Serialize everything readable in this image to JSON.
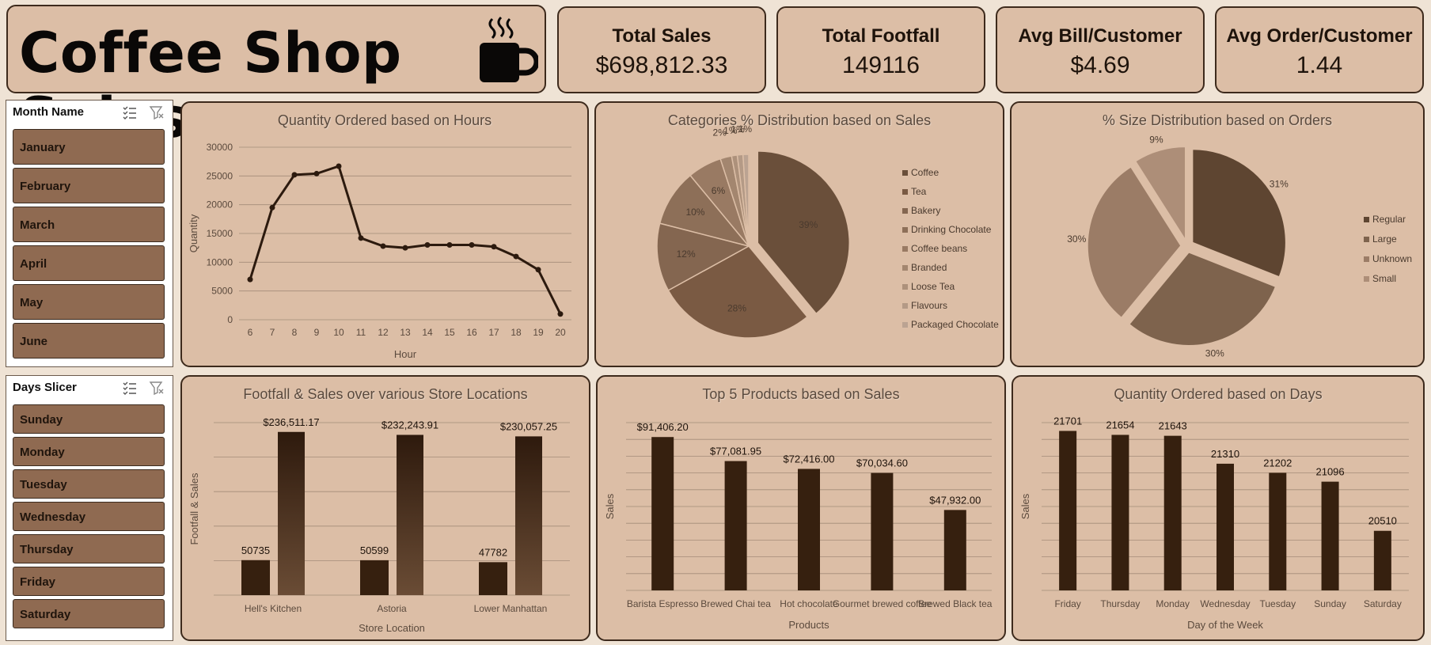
{
  "header": {
    "title": "Coffee Shop Sales",
    "icon": "coffee-cup-icon"
  },
  "kpis": [
    {
      "label": "Total Sales",
      "value": "$698,812.33"
    },
    {
      "label": "Total Footfall",
      "value": "149116"
    },
    {
      "label": "Avg Bill/Customer",
      "value": "$4.69"
    },
    {
      "label": "Avg Order/Customer",
      "value": "1.44"
    }
  ],
  "month_slicer": {
    "title": "Month Name",
    "items": [
      "January",
      "February",
      "March",
      "April",
      "May",
      "June"
    ]
  },
  "days_slicer": {
    "title": "Days Slicer",
    "items": [
      "Sunday",
      "Monday",
      "Tuesday",
      "Wednesday",
      "Thursday",
      "Friday",
      "Saturday"
    ]
  },
  "colors": {
    "background": "#efe3d5",
    "panel": "#dcbea6",
    "dark": "#3a2212",
    "slicer_item": "#8f6a51"
  },
  "chart_data": [
    {
      "id": "hours",
      "type": "line",
      "title": "Quantity Ordered based on Hours",
      "xlabel": "Hour",
      "ylabel": "Quantity",
      "x": [
        6,
        7,
        8,
        9,
        10,
        11,
        12,
        13,
        14,
        15,
        16,
        17,
        18,
        19,
        20
      ],
      "values": [
        7000,
        19500,
        25200,
        25400,
        26700,
        14200,
        12800,
        12500,
        13000,
        13000,
        13000,
        12700,
        11000,
        8700,
        1000
      ],
      "ylim": [
        0,
        30000
      ],
      "yticks": [
        0,
        5000,
        10000,
        15000,
        20000,
        25000,
        30000
      ],
      "grid": true
    },
    {
      "id": "categories",
      "type": "pie",
      "title": "Categories % Distribution based on Sales",
      "categories": [
        "Coffee",
        "Tea",
        "Bakery",
        "Drinking Chocolate",
        "Coffee beans",
        "Branded",
        "Loose Tea",
        "Flavours",
        "Packaged Chocolate"
      ],
      "values": [
        39,
        28,
        12,
        10,
        6,
        2,
        1,
        1,
        1
      ],
      "labels": [
        "39%",
        "28%",
        "12%",
        "10%",
        "6%",
        "2%",
        "1%",
        "1%",
        "1%"
      ],
      "colors": [
        "#6a4f3a",
        "#7a5a43",
        "#846650",
        "#8d6f58",
        "#997a63",
        "#a3866f",
        "#ad917b",
        "#b49a86",
        "#bba392"
      ],
      "legend": "right"
    },
    {
      "id": "sizes",
      "type": "pie",
      "title": "% Size Distribution based on Orders",
      "categories": [
        "Regular",
        "Large",
        "Unknown",
        "Small"
      ],
      "values": [
        31,
        30,
        30,
        9
      ],
      "labels": [
        "31%",
        "30%",
        "30%",
        "9%"
      ],
      "colors": [
        "#5e4531",
        "#7e634d",
        "#9b7c66",
        "#ad8e78"
      ],
      "legend": "right"
    },
    {
      "id": "stores",
      "type": "bar",
      "title": "Footfall & Sales over various Store Locations",
      "xlabel": "Store Location",
      "ylabel": "Footfall & Sales",
      "categories": [
        "Hell's Kitchen",
        "Astoria",
        "Lower Manhattan"
      ],
      "series": [
        {
          "values": [
            50735,
            50599,
            47782
          ],
          "labels": [
            "50735",
            "50599",
            "47782"
          ]
        },
        {
          "values": [
            236511.17,
            232243.91,
            230057.25
          ],
          "labels": [
            "$236,511.17",
            "$232,243.91",
            "$230,057.25"
          ]
        }
      ],
      "ylim": [
        0,
        250000
      ],
      "grid": true
    },
    {
      "id": "products",
      "type": "bar",
      "title": "Top 5 Products based on Sales",
      "xlabel": "Products",
      "ylabel": "Sales",
      "categories": [
        "Barista Espresso",
        "Brewed Chai tea",
        "Hot chocolate",
        "Gourmet brewed coffee",
        "Brewed Black tea"
      ],
      "values": [
        91406.2,
        77081.95,
        72416.0,
        70034.6,
        47932.0
      ],
      "labels": [
        "$91,406.20",
        "$77,081.95",
        "$72,416.00",
        "$70,034.60",
        "$47,932.00"
      ],
      "ylim": [
        0,
        100000
      ],
      "grid": true
    },
    {
      "id": "days",
      "type": "bar",
      "title": "Quantity Ordered based on Days",
      "xlabel": "Day of the Week",
      "ylabel": "Sales",
      "categories": [
        "Friday",
        "Thursday",
        "Monday",
        "Wednesday",
        "Tuesday",
        "Sunday",
        "Saturday"
      ],
      "values": [
        21701,
        21654,
        21643,
        21310,
        21202,
        21096,
        20510
      ],
      "labels": [
        "21701",
        "21654",
        "21643",
        "21310",
        "21202",
        "21096",
        "20510"
      ],
      "ylim": [
        19800,
        21800
      ],
      "grid": true
    }
  ]
}
